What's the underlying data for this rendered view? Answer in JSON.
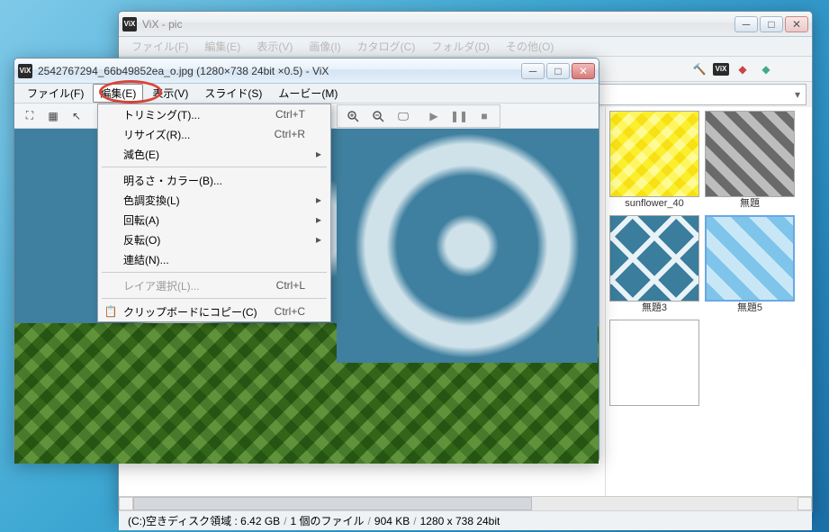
{
  "main_window": {
    "title": "ViX - pic",
    "menubar": [
      "ファイル(F)",
      "編集(E)",
      "表示(V)",
      "画像(I)",
      "カタログ(C)",
      "フォルダ(D)",
      "その他(O)"
    ],
    "toolbar_icons": [
      "hammer",
      "vix",
      "book-red",
      "book-green"
    ],
    "thumbs": [
      {
        "label": "sunflower_40",
        "patt": "sun"
      },
      {
        "label": "無題",
        "patt": "gray"
      },
      {
        "label": "無題3",
        "patt": "x"
      },
      {
        "label": "無題5",
        "patt": "lblue"
      }
    ],
    "status_parts": [
      "(C:)空きディスク領域 : 6.42 GB",
      "1 個のファイル",
      "904 KB",
      "1280 x 738 24bit"
    ]
  },
  "viewer_window": {
    "title": "2542767294_66b49852ea_o.jpg (1280×738 24bit ×0.5) - ViX",
    "menubar": [
      "ファイル(F)",
      "編集(E)",
      "表示(V)",
      "スライド(S)",
      "ムービー(M)"
    ],
    "highlighted_menu_index": 1,
    "toolbar_left": [
      "fit-icon",
      "grid-icon",
      "pointer-icon"
    ],
    "toolbar_right": [
      "zoom-in-icon",
      "zoom-out-icon",
      "screen-icon",
      "divider",
      "play-icon",
      "pause-icon",
      "stop-icon"
    ],
    "dropdown": {
      "items": [
        {
          "label": "トリミング(T)...",
          "shortcut": "Ctrl+T"
        },
        {
          "label": "リサイズ(R)...",
          "shortcut": "Ctrl+R"
        },
        {
          "label": "減色(E)",
          "arrow": true
        },
        {
          "sep": true
        },
        {
          "label": "明るさ・カラー(B)..."
        },
        {
          "label": "色調変換(L)",
          "arrow": true
        },
        {
          "label": "回転(A)",
          "arrow": true
        },
        {
          "label": "反転(O)",
          "arrow": true
        },
        {
          "label": "連結(N)..."
        },
        {
          "sep": true
        },
        {
          "label": "レイア選択(L)...",
          "shortcut": "Ctrl+L",
          "disabled": true
        },
        {
          "sep": true
        },
        {
          "label": "クリップボードにコピー(C)",
          "shortcut": "Ctrl+C",
          "icon": "copy"
        }
      ]
    }
  }
}
